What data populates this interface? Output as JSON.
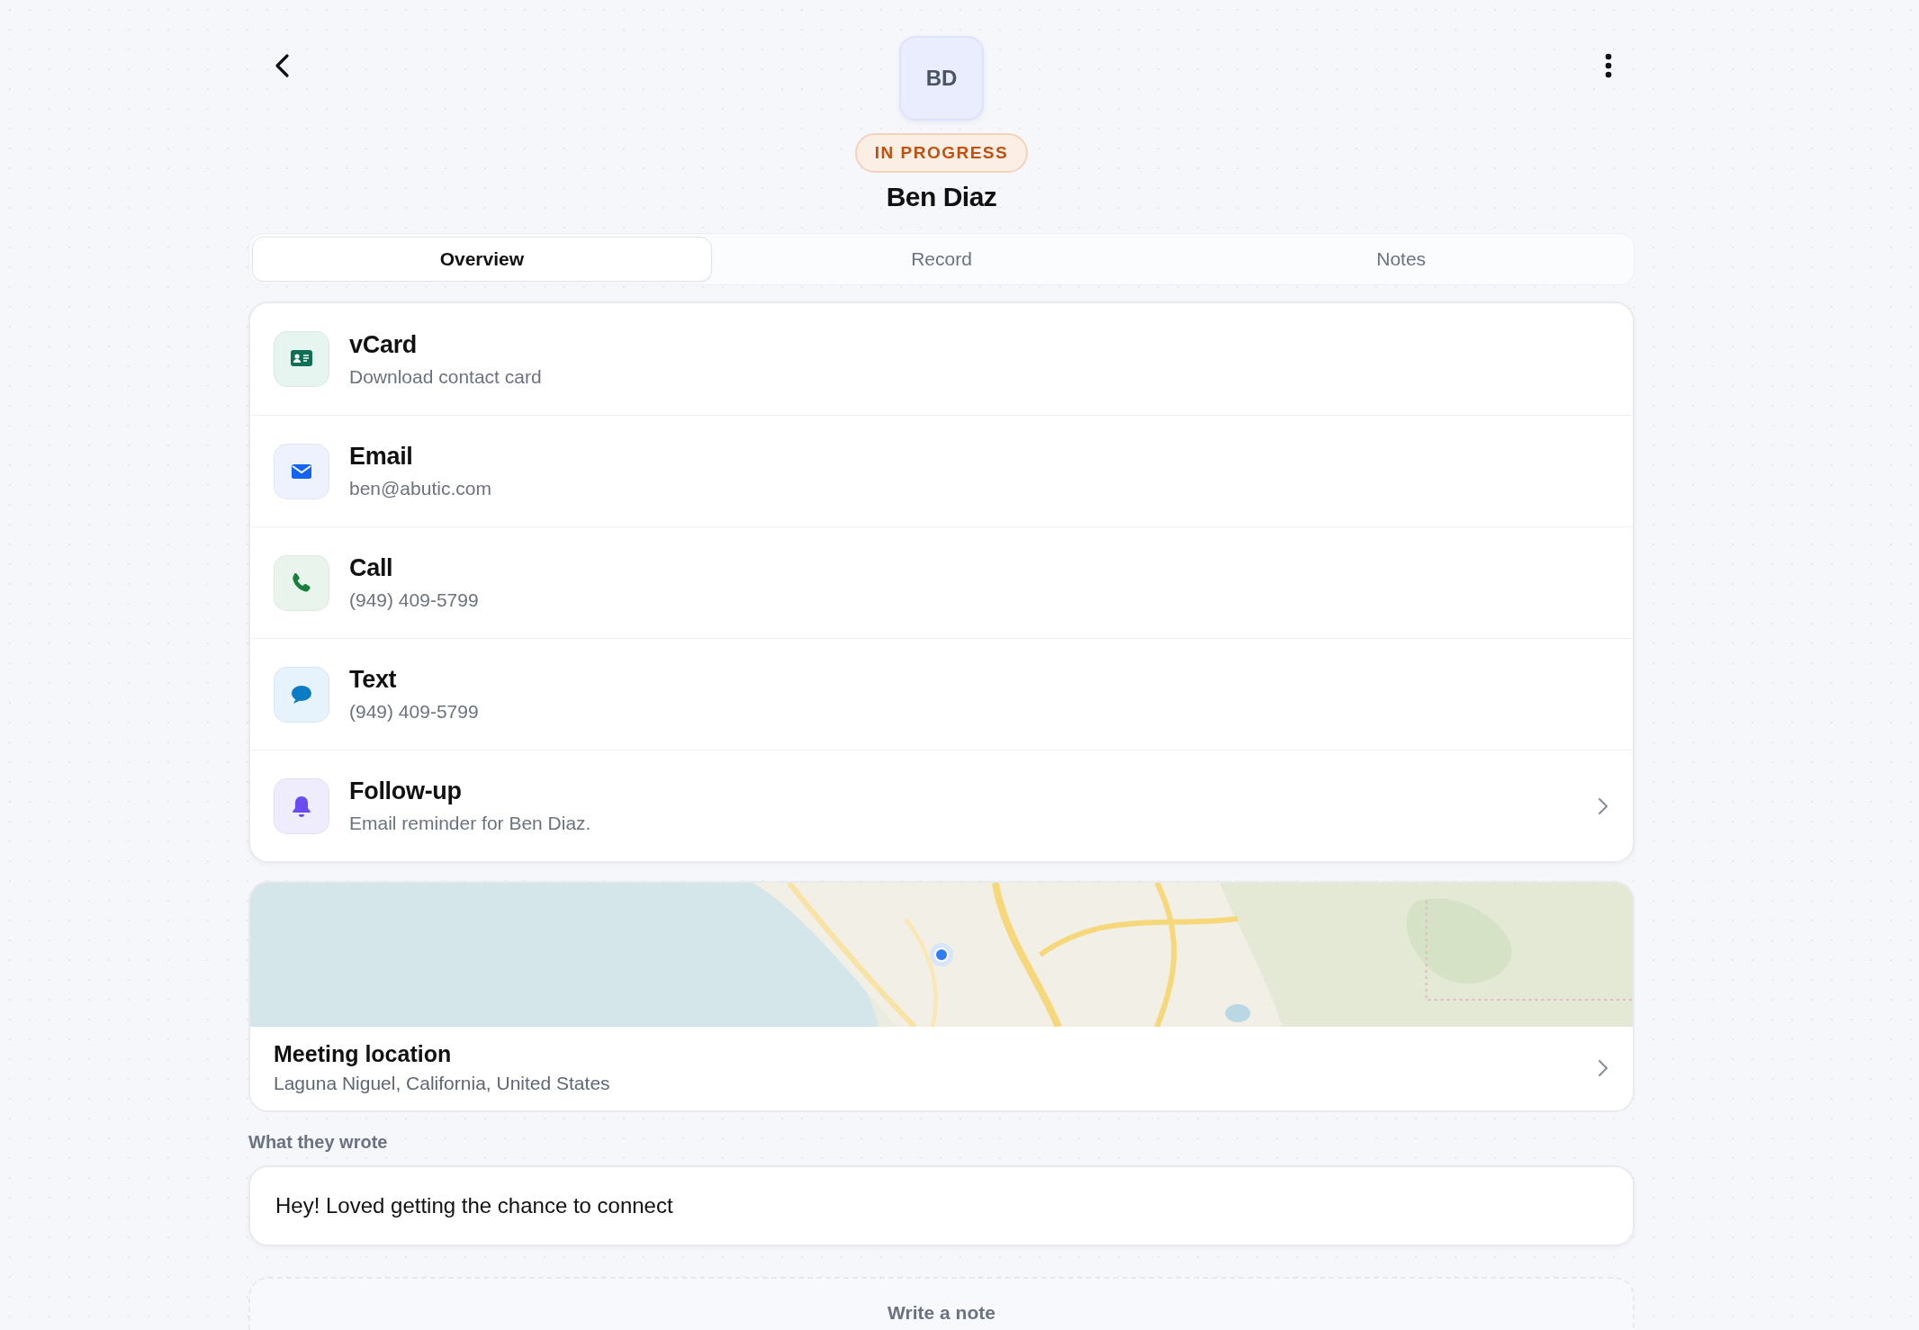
{
  "header": {
    "avatar": "BD",
    "status": {
      "label": "IN PROGRESS",
      "kind": "in_progress"
    },
    "name": "Ben Diaz"
  },
  "tabs": [
    {
      "label": "Overview",
      "selected": true
    },
    {
      "label": "Record",
      "selected": false
    },
    {
      "label": "Notes",
      "selected": false
    }
  ],
  "actions": [
    {
      "kind": "vcard",
      "title": "vCard",
      "subtitle": "Download contact card",
      "navigable": false
    },
    {
      "kind": "email",
      "title": "Email",
      "subtitle": "ben@abutic.com",
      "navigable": false
    },
    {
      "kind": "call",
      "title": "Call",
      "subtitle": "(949) 409-5799",
      "navigable": false
    },
    {
      "kind": "text",
      "title": "Text",
      "subtitle": "(949) 409-5799",
      "navigable": false
    },
    {
      "kind": "followup",
      "title": "Follow-up",
      "subtitle": "Email reminder for Ben Diaz.",
      "navigable": true
    }
  ],
  "location": {
    "title": "Meeting location",
    "address": "Laguna Niguel, California, United States"
  },
  "message": {
    "label": "What they wrote",
    "text": "Hey! Loved getting the chance to connect"
  },
  "note": {
    "placeholder": "Write a note"
  }
}
